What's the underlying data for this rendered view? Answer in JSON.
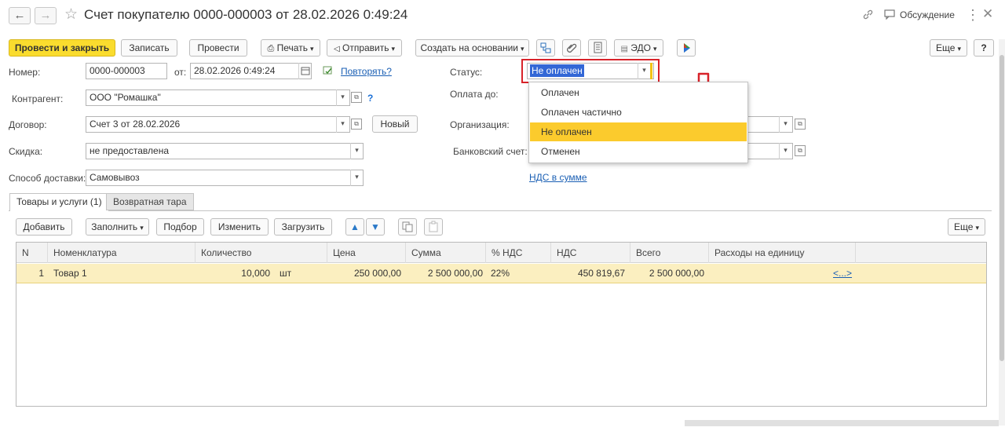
{
  "header": {
    "title": "Счет покупателю 0000-000003 от 28.02.2026 0:49:24",
    "discussion_label": "Обсуждение"
  },
  "toolbar": {
    "post_close": "Провести и закрыть",
    "save": "Записать",
    "post": "Провести",
    "print": "Печать",
    "send": "Отправить",
    "create_based": "Создать на основании",
    "edo": "ЭДО",
    "more": "Еще",
    "help": "?"
  },
  "form": {
    "number_label": "Номер:",
    "number_value": "0000-000003",
    "date_label": "от:",
    "date_value": "28.02.2026  0:49:24",
    "repeat_link": "Повторять?",
    "counterparty_label": "Контрагент:",
    "counterparty_value": "ООО \"Ромашка\"",
    "contract_label": "Договор:",
    "contract_value": "Счет 3 от 28.02.2026",
    "new_button": "Новый",
    "discount_label": "Скидка:",
    "discount_value": "не предоставлена",
    "delivery_label": "Способ доставки:",
    "delivery_value": "Самовывоз",
    "status_label": "Статус:",
    "status_value": "Не оплачен",
    "payment_label": "Оплата до:",
    "org_label": "Организация:",
    "bank_label": "Банковский счет:",
    "vat_link": "НДС в сумме"
  },
  "status_options": [
    {
      "label": "Оплачен",
      "selected": false
    },
    {
      "label": "Оплачен частично",
      "selected": false
    },
    {
      "label": "Не оплачен",
      "selected": true
    },
    {
      "label": "Отменен",
      "selected": false
    }
  ],
  "tabs": [
    {
      "label": "Товары и услуги (1)",
      "active": true
    },
    {
      "label": "Возвратная тара",
      "active": false
    }
  ],
  "table_toolbar": {
    "add": "Добавить",
    "fill": "Заполнить",
    "pick": "Подбор",
    "change": "Изменить",
    "load": "Загрузить",
    "more": "Еще"
  },
  "table": {
    "columns": [
      "N",
      "Номенклатура",
      "Количество",
      "Цена",
      "Сумма",
      "% НДС",
      "НДС",
      "Всего",
      "Расходы на единицу"
    ],
    "rows": [
      {
        "n": "1",
        "item": "Товар 1",
        "qty": "10,000",
        "unit": "шт",
        "price": "250 000,00",
        "sum": "2 500 000,00",
        "vat_rate": "22%",
        "vat": "450 819,67",
        "total": "2 500 000,00",
        "costs": "<...>"
      }
    ]
  },
  "colors": {
    "primary_button": "#fadc2e",
    "selected_row": "#fbefc0",
    "dropdown_highlight": "#fbcb2d",
    "annotation_red": "#d8232a",
    "link": "#1a5fb4"
  }
}
